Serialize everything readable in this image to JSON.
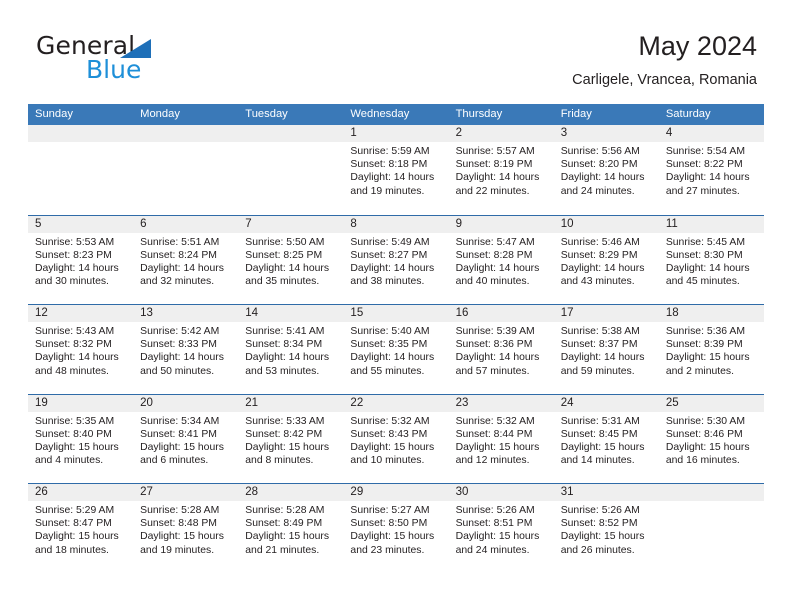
{
  "brand": {
    "name_top": "General",
    "name_bottom": "Blue",
    "triangle_color": "#1e6fb8",
    "blue_text_color": "#1e8fd8"
  },
  "header": {
    "title": "May 2024",
    "location": "Carligele, Vrancea, Romania"
  },
  "theme": {
    "header_row_bg": "#3a79b8",
    "header_row_text": "#ffffff",
    "daynum_bg": "#efefef",
    "week_divider": "#2f6ba8",
    "text": "#231f20"
  },
  "calendar": {
    "weekday_headers": [
      "Sunday",
      "Monday",
      "Tuesday",
      "Wednesday",
      "Thursday",
      "Friday",
      "Saturday"
    ],
    "labels": {
      "sunrise": "Sunrise:",
      "sunset": "Sunset:",
      "daylight": "Daylight:"
    },
    "weeks": [
      [
        {
          "day": ""
        },
        {
          "day": ""
        },
        {
          "day": ""
        },
        {
          "day": "1",
          "sunrise": "Sunrise: 5:59 AM",
          "sunset": "Sunset: 8:18 PM",
          "daylight_l1": "Daylight: 14 hours",
          "daylight_l2": "and 19 minutes."
        },
        {
          "day": "2",
          "sunrise": "Sunrise: 5:57 AM",
          "sunset": "Sunset: 8:19 PM",
          "daylight_l1": "Daylight: 14 hours",
          "daylight_l2": "and 22 minutes."
        },
        {
          "day": "3",
          "sunrise": "Sunrise: 5:56 AM",
          "sunset": "Sunset: 8:20 PM",
          "daylight_l1": "Daylight: 14 hours",
          "daylight_l2": "and 24 minutes."
        },
        {
          "day": "4",
          "sunrise": "Sunrise: 5:54 AM",
          "sunset": "Sunset: 8:22 PM",
          "daylight_l1": "Daylight: 14 hours",
          "daylight_l2": "and 27 minutes."
        }
      ],
      [
        {
          "day": "5",
          "sunrise": "Sunrise: 5:53 AM",
          "sunset": "Sunset: 8:23 PM",
          "daylight_l1": "Daylight: 14 hours",
          "daylight_l2": "and 30 minutes."
        },
        {
          "day": "6",
          "sunrise": "Sunrise: 5:51 AM",
          "sunset": "Sunset: 8:24 PM",
          "daylight_l1": "Daylight: 14 hours",
          "daylight_l2": "and 32 minutes."
        },
        {
          "day": "7",
          "sunrise": "Sunrise: 5:50 AM",
          "sunset": "Sunset: 8:25 PM",
          "daylight_l1": "Daylight: 14 hours",
          "daylight_l2": "and 35 minutes."
        },
        {
          "day": "8",
          "sunrise": "Sunrise: 5:49 AM",
          "sunset": "Sunset: 8:27 PM",
          "daylight_l1": "Daylight: 14 hours",
          "daylight_l2": "and 38 minutes."
        },
        {
          "day": "9",
          "sunrise": "Sunrise: 5:47 AM",
          "sunset": "Sunset: 8:28 PM",
          "daylight_l1": "Daylight: 14 hours",
          "daylight_l2": "and 40 minutes."
        },
        {
          "day": "10",
          "sunrise": "Sunrise: 5:46 AM",
          "sunset": "Sunset: 8:29 PM",
          "daylight_l1": "Daylight: 14 hours",
          "daylight_l2": "and 43 minutes."
        },
        {
          "day": "11",
          "sunrise": "Sunrise: 5:45 AM",
          "sunset": "Sunset: 8:30 PM",
          "daylight_l1": "Daylight: 14 hours",
          "daylight_l2": "and 45 minutes."
        }
      ],
      [
        {
          "day": "12",
          "sunrise": "Sunrise: 5:43 AM",
          "sunset": "Sunset: 8:32 PM",
          "daylight_l1": "Daylight: 14 hours",
          "daylight_l2": "and 48 minutes."
        },
        {
          "day": "13",
          "sunrise": "Sunrise: 5:42 AM",
          "sunset": "Sunset: 8:33 PM",
          "daylight_l1": "Daylight: 14 hours",
          "daylight_l2": "and 50 minutes."
        },
        {
          "day": "14",
          "sunrise": "Sunrise: 5:41 AM",
          "sunset": "Sunset: 8:34 PM",
          "daylight_l1": "Daylight: 14 hours",
          "daylight_l2": "and 53 minutes."
        },
        {
          "day": "15",
          "sunrise": "Sunrise: 5:40 AM",
          "sunset": "Sunset: 8:35 PM",
          "daylight_l1": "Daylight: 14 hours",
          "daylight_l2": "and 55 minutes."
        },
        {
          "day": "16",
          "sunrise": "Sunrise: 5:39 AM",
          "sunset": "Sunset: 8:36 PM",
          "daylight_l1": "Daylight: 14 hours",
          "daylight_l2": "and 57 minutes."
        },
        {
          "day": "17",
          "sunrise": "Sunrise: 5:38 AM",
          "sunset": "Sunset: 8:37 PM",
          "daylight_l1": "Daylight: 14 hours",
          "daylight_l2": "and 59 minutes."
        },
        {
          "day": "18",
          "sunrise": "Sunrise: 5:36 AM",
          "sunset": "Sunset: 8:39 PM",
          "daylight_l1": "Daylight: 15 hours",
          "daylight_l2": "and 2 minutes."
        }
      ],
      [
        {
          "day": "19",
          "sunrise": "Sunrise: 5:35 AM",
          "sunset": "Sunset: 8:40 PM",
          "daylight_l1": "Daylight: 15 hours",
          "daylight_l2": "and 4 minutes."
        },
        {
          "day": "20",
          "sunrise": "Sunrise: 5:34 AM",
          "sunset": "Sunset: 8:41 PM",
          "daylight_l1": "Daylight: 15 hours",
          "daylight_l2": "and 6 minutes."
        },
        {
          "day": "21",
          "sunrise": "Sunrise: 5:33 AM",
          "sunset": "Sunset: 8:42 PM",
          "daylight_l1": "Daylight: 15 hours",
          "daylight_l2": "and 8 minutes."
        },
        {
          "day": "22",
          "sunrise": "Sunrise: 5:32 AM",
          "sunset": "Sunset: 8:43 PM",
          "daylight_l1": "Daylight: 15 hours",
          "daylight_l2": "and 10 minutes."
        },
        {
          "day": "23",
          "sunrise": "Sunrise: 5:32 AM",
          "sunset": "Sunset: 8:44 PM",
          "daylight_l1": "Daylight: 15 hours",
          "daylight_l2": "and 12 minutes."
        },
        {
          "day": "24",
          "sunrise": "Sunrise: 5:31 AM",
          "sunset": "Sunset: 8:45 PM",
          "daylight_l1": "Daylight: 15 hours",
          "daylight_l2": "and 14 minutes."
        },
        {
          "day": "25",
          "sunrise": "Sunrise: 5:30 AM",
          "sunset": "Sunset: 8:46 PM",
          "daylight_l1": "Daylight: 15 hours",
          "daylight_l2": "and 16 minutes."
        }
      ],
      [
        {
          "day": "26",
          "sunrise": "Sunrise: 5:29 AM",
          "sunset": "Sunset: 8:47 PM",
          "daylight_l1": "Daylight: 15 hours",
          "daylight_l2": "and 18 minutes."
        },
        {
          "day": "27",
          "sunrise": "Sunrise: 5:28 AM",
          "sunset": "Sunset: 8:48 PM",
          "daylight_l1": "Daylight: 15 hours",
          "daylight_l2": "and 19 minutes."
        },
        {
          "day": "28",
          "sunrise": "Sunrise: 5:28 AM",
          "sunset": "Sunset: 8:49 PM",
          "daylight_l1": "Daylight: 15 hours",
          "daylight_l2": "and 21 minutes."
        },
        {
          "day": "29",
          "sunrise": "Sunrise: 5:27 AM",
          "sunset": "Sunset: 8:50 PM",
          "daylight_l1": "Daylight: 15 hours",
          "daylight_l2": "and 23 minutes."
        },
        {
          "day": "30",
          "sunrise": "Sunrise: 5:26 AM",
          "sunset": "Sunset: 8:51 PM",
          "daylight_l1": "Daylight: 15 hours",
          "daylight_l2": "and 24 minutes."
        },
        {
          "day": "31",
          "sunrise": "Sunrise: 5:26 AM",
          "sunset": "Sunset: 8:52 PM",
          "daylight_l1": "Daylight: 15 hours",
          "daylight_l2": "and 26 minutes."
        },
        {
          "day": ""
        }
      ]
    ]
  }
}
